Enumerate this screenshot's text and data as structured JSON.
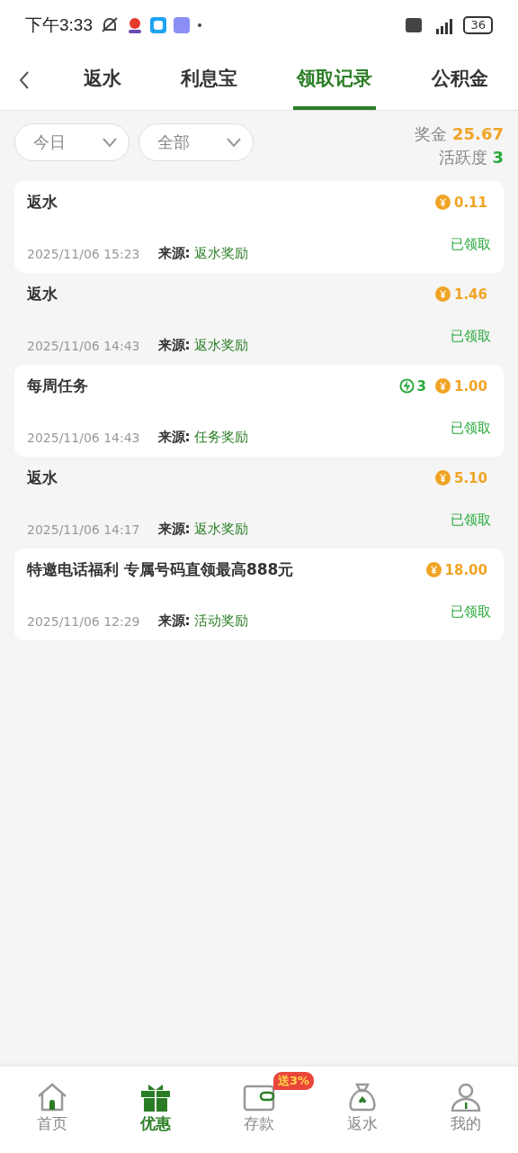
{
  "status_bar": {
    "time": "下午3:33",
    "battery": "36"
  },
  "tabs": [
    {
      "label": "返水",
      "selected": false
    },
    {
      "label": "利息宝",
      "selected": false
    },
    {
      "label": "领取记录",
      "selected": true
    },
    {
      "label": "公积金",
      "selected": false
    }
  ],
  "filters": [
    {
      "value": "今日"
    },
    {
      "value": "全部"
    }
  ],
  "summary": {
    "bonus_label": "奖金",
    "bonus": "25.67",
    "activity_label": "活跃度",
    "activity": "3"
  },
  "records": [
    {
      "title": "返水",
      "amount": "0.11",
      "time": "2025/11/06 15:23",
      "source_label": "来源:",
      "source": "返水奖励",
      "status": "已领取"
    },
    {
      "title": "返水",
      "amount": "1.46",
      "time": "2025/11/06 14:43",
      "source_label": "来源:",
      "source": "返水奖励",
      "status": "已领取"
    },
    {
      "title": "每周任务",
      "activity": "3",
      "amount": "1.00",
      "time": "2025/11/06 14:43",
      "source_label": "来源:",
      "source": "任务奖励",
      "status": "已领取"
    },
    {
      "title": "返水",
      "amount": "5.10",
      "time": "2025/11/06 14:17",
      "source_label": "来源:",
      "source": "返水奖励",
      "status": "已领取"
    },
    {
      "title": "特邀电话福利 专属号码直领最高888元",
      "amount": "18.00",
      "time": "2025/11/06 12:29",
      "source_label": "来源:",
      "source": "活动奖励",
      "status": "已领取"
    }
  ],
  "nav": [
    {
      "label": "首页",
      "kind": "home",
      "selected": false
    },
    {
      "label": "优惠",
      "kind": "gift",
      "selected": true
    },
    {
      "label": "存款",
      "kind": "wallet",
      "selected": false,
      "badge": "送3%"
    },
    {
      "label": "返水",
      "kind": "bag",
      "selected": false
    },
    {
      "label": "我的",
      "kind": "user",
      "selected": false
    }
  ]
}
